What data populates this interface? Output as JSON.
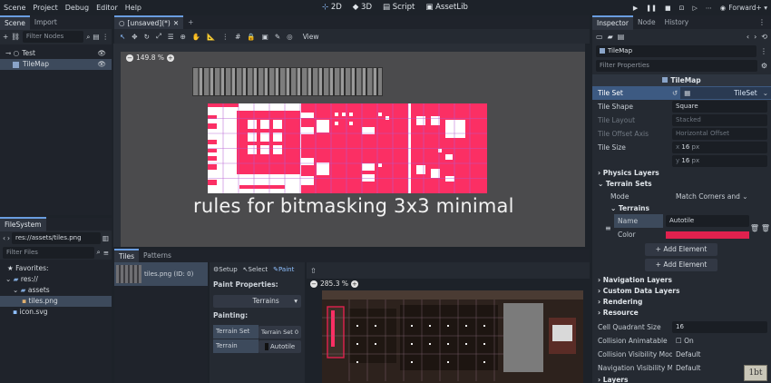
{
  "menubar": {
    "items": [
      "Scene",
      "Project",
      "Debug",
      "Editor",
      "Help"
    ],
    "modes": [
      "2D",
      "3D",
      "Script",
      "AssetLib"
    ],
    "active_mode": "2D",
    "renderer": "Forward+"
  },
  "scene_dock": {
    "tabs": [
      "Scene",
      "Import"
    ],
    "filter_placeholder": "Filter Nodes",
    "tree": [
      {
        "label": "Test",
        "icon": "node2d-icon"
      },
      {
        "label": "TileMap",
        "icon": "tilemap-icon"
      }
    ]
  },
  "filesystem_dock": {
    "title": "FileSystem",
    "path": "res://assets/tiles.png",
    "filter_placeholder": "Filter Files",
    "favorites_label": "Favorites:",
    "tree": [
      {
        "label": "res://"
      },
      {
        "label": "assets"
      },
      {
        "label": "tiles.png"
      },
      {
        "label": "icon.svg"
      }
    ]
  },
  "editor_tab": {
    "label": "[unsaved](*)"
  },
  "toolbar": {
    "view_label": "View"
  },
  "viewport": {
    "zoom": "149.8 %",
    "caption": "rules for bitmasking 3x3 minimal"
  },
  "bottom_panel": {
    "tabs": [
      "Tiles",
      "Patterns"
    ],
    "source_item": "tiles.png (ID: 0)",
    "tools": [
      "Setup",
      "Select",
      "Paint"
    ],
    "paint_properties_label": "Paint Properties:",
    "paint_mode_value": "Terrains",
    "painting_label": "Painting:",
    "terrain_set_label": "Terrain Set",
    "terrain_set_value": "Terrain Set 0",
    "terrain_label": "Terrain",
    "terrain_value": "Autotile",
    "atlas_zoom": "285.3 %"
  },
  "inspector": {
    "tabs": [
      "Inspector",
      "Node",
      "History"
    ],
    "object": "TileMap",
    "filter_placeholder": "Filter Properties",
    "class_header": "TileMap",
    "tile_set_label": "Tile Set",
    "tile_set_value": "TileSet",
    "props": [
      {
        "label": "Tile Shape",
        "value": "Square",
        "disabled": false
      },
      {
        "label": "Tile Layout",
        "value": "Stacked",
        "disabled": true
      },
      {
        "label": "Tile Offset Axis",
        "value": "Horizontal Offset",
        "disabled": true
      }
    ],
    "tile_size_label": "Tile Size",
    "tile_size_x": "16",
    "tile_size_y": "16",
    "unit": "px",
    "sections": [
      "Physics Layers",
      "Terrain Sets"
    ],
    "mode_label": "Mode",
    "mode_value": "Match Corners and",
    "terrains_label": "Terrains",
    "terrain_name_label": "Name",
    "terrain_name_value": "Autotile",
    "terrain_color_label": "Color",
    "terrain_color": "#e0214e",
    "add_element": "Add Element",
    "more_sections": [
      "Navigation Layers",
      "Custom Data Layers",
      "Rendering",
      "Resource"
    ],
    "cell_quadrant_label": "Cell Quadrant Size",
    "cell_quadrant_value": "16",
    "collision_animatable_label": "Collision Animatable",
    "collision_animatable_value": "On",
    "collision_visibility_label": "Collision Visibility Mode",
    "collision_visibility_value": "Default",
    "navigation_visibility_label": "Navigation Visibility Mode",
    "navigation_visibility_value": "Default",
    "layers_label": "Layers"
  },
  "colors": {
    "accent": "#6a9de0",
    "terrain": "#fb2f64",
    "background": "#1d2229"
  }
}
